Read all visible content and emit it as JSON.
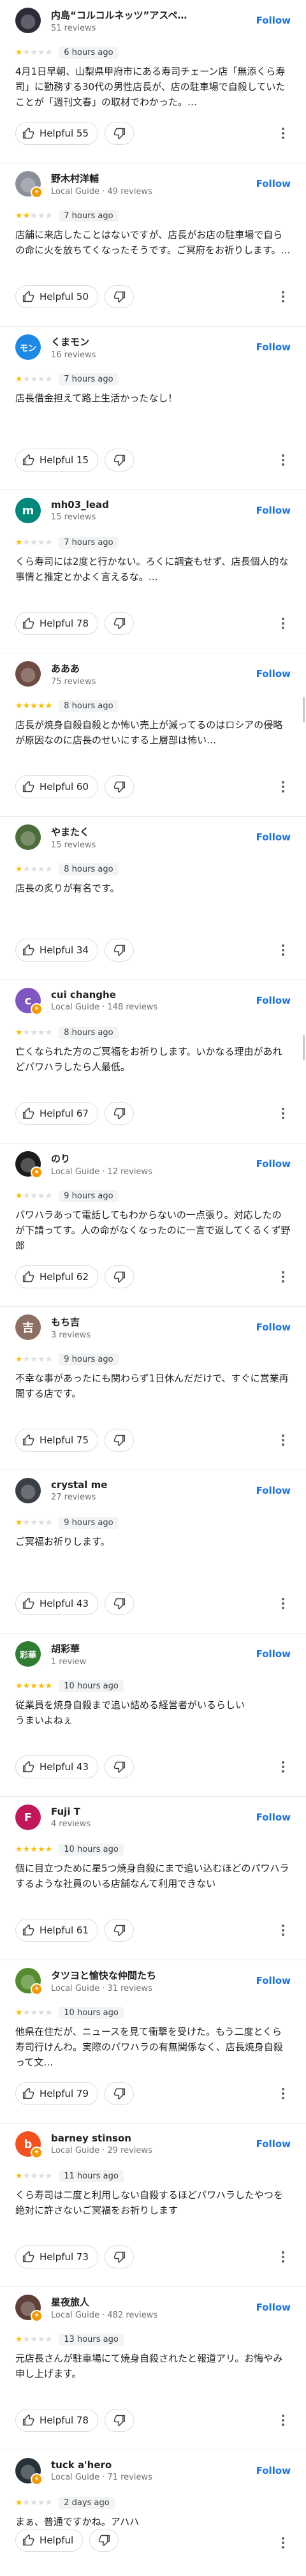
{
  "reviews": [
    {
      "name": "内島“コルコルネッツ”アスペ…",
      "avatar": {
        "kind": "photo",
        "color": "#2b2b3a",
        "glyph": "●"
      },
      "local_guide": false,
      "meta": "51 reviews",
      "follow_label": "Follow",
      "rating": 1,
      "when": "6 hours ago",
      "text": "4月1日早朝、山梨県甲府市にある寿司チェーン店「無添くら寿司」に勤務する30代の男性店長が、店の駐車場で自殺していたことが「週刊文春」の取材でわかった。…",
      "helpful_label": "Helpful 55"
    },
    {
      "name": "野木村洋輔",
      "avatar": {
        "kind": "photo",
        "color": "#8a8f9a",
        "glyph": "●"
      },
      "local_guide": true,
      "meta": "Local Guide · 49 reviews",
      "follow_label": "Follow",
      "rating": 2,
      "when": "7 hours ago",
      "text": "店舗に来店したことはないですが、店長がお店の駐車場で自らの命に火を放ちてくなったそうです。ご冥府をお祈りします。…",
      "helpful_label": "Helpful 50"
    },
    {
      "name": "くまモン",
      "avatar": {
        "kind": "letter",
        "color": "#1e88e5",
        "glyph": "モン"
      },
      "local_guide": false,
      "meta": "16 reviews",
      "follow_label": "Follow",
      "rating": 1,
      "when": "7 hours ago",
      "text": "店長借金担えて路上生活かったなし！",
      "helpful_label": "Helpful 15"
    },
    {
      "name": "mh03_lead",
      "avatar": {
        "kind": "letter",
        "color": "#00897b",
        "glyph": "m"
      },
      "local_guide": false,
      "meta": "15 reviews",
      "follow_label": "Follow",
      "rating": 1,
      "when": "7 hours ago",
      "text": "くら寿司には2度と行かない。ろくに調査もせず、店長個人的な事情と推定とかよく言えるな。…",
      "helpful_label": "Helpful 78"
    },
    {
      "name": "あああ",
      "avatar": {
        "kind": "photo",
        "color": "#6d4c41",
        "glyph": "●"
      },
      "local_guide": false,
      "meta": "75 reviews",
      "follow_label": "Follow",
      "rating": 5,
      "when": "8 hours ago",
      "text": "店長が焼身自殺自殺とか怖い売上が減ってるのはロシアの侵略が原因なのに店長のせいにする上層部は怖い…",
      "helpful_label": "Helpful 60"
    },
    {
      "name": "やまたく",
      "avatar": {
        "kind": "photo",
        "color": "#4e6b3a",
        "glyph": "●"
      },
      "local_guide": false,
      "meta": "15 reviews",
      "follow_label": "Follow",
      "rating": 1,
      "when": "8 hours ago",
      "text": "店長の炙りが有名です。",
      "helpful_label": "Helpful 34"
    },
    {
      "name": "cui changhe",
      "avatar": {
        "kind": "letter",
        "color": "#7e57c2",
        "glyph": "c"
      },
      "local_guide": true,
      "meta": "Local Guide · 148 reviews",
      "follow_label": "Follow",
      "rating": 1,
      "when": "8 hours ago",
      "text": "亡くなられた方のご冥福をお祈りします。いかなる理由があれどパワハラしたら人最低。",
      "helpful_label": "Helpful 67"
    },
    {
      "name": "のり",
      "avatar": {
        "kind": "photo",
        "color": "#1c1c1c",
        "glyph": "●"
      },
      "local_guide": true,
      "meta": "Local Guide · 12 reviews",
      "follow_label": "Follow",
      "rating": 1,
      "when": "9 hours ago",
      "text": "パワハラあって電話してもわからないの一点張り。対応したのが下請ってす。人の命がなくなったのに一言で返してくるくず野郎",
      "helpful_label": "Helpful 62"
    },
    {
      "name": "もち吉",
      "avatar": {
        "kind": "letter",
        "color": "#8d6e63",
        "glyph": "吉"
      },
      "local_guide": false,
      "meta": "3 reviews",
      "follow_label": "Follow",
      "rating": 1,
      "when": "9 hours ago",
      "text": "不幸な事があったにも関わらず1日休んだだけで、すぐに営業再開する店です。",
      "helpful_label": "Helpful 75"
    },
    {
      "name": "crystal me",
      "avatar": {
        "kind": "photo",
        "color": "#3a3f47",
        "glyph": "●"
      },
      "local_guide": false,
      "meta": "27 reviews",
      "follow_label": "Follow",
      "rating": 1,
      "when": "9 hours ago",
      "text": "ご冥福お祈りします。",
      "helpful_label": "Helpful 43"
    },
    {
      "name": "胡彩華",
      "avatar": {
        "kind": "letter",
        "color": "#2e7d32",
        "glyph": "彩華"
      },
      "local_guide": false,
      "meta": "1 review",
      "follow_label": "Follow",
      "rating": 5,
      "when": "10 hours ago",
      "text": "従業員を焼身自殺まで追い詰める経営者がいるらしい\nうまいよねぇ",
      "helpful_label": "Helpful 43"
    },
    {
      "name": "Fuji T",
      "avatar": {
        "kind": "letter",
        "color": "#c2185b",
        "glyph": "F"
      },
      "local_guide": false,
      "meta": "4 reviews",
      "follow_label": "Follow",
      "rating": 5,
      "when": "10 hours ago",
      "text": "個に目立つために星5つ焼身自殺にまで追い込むほどのパワハラするような社員のいる店舗なんて利用できない",
      "helpful_label": "Helpful 61"
    },
    {
      "name": "タツヨと愉快な仲間たち",
      "avatar": {
        "kind": "photo",
        "color": "#558b2f",
        "glyph": "●"
      },
      "local_guide": true,
      "meta": "Local Guide · 31 reviews",
      "follow_label": "Follow",
      "rating": 1,
      "when": "10 hours ago",
      "text": "他県在住だが、ニュースを見て衝撃を受けた。もう二度とくら寿司行けんわ。実際のパワハラの有無関係なく、店長焼身自殺って文…",
      "helpful_label": "Helpful 79"
    },
    {
      "name": "barney stinson",
      "avatar": {
        "kind": "letter",
        "color": "#f4511e",
        "glyph": "b"
      },
      "local_guide": true,
      "meta": "Local Guide · 29 reviews",
      "follow_label": "Follow",
      "rating": 1,
      "when": "11 hours ago",
      "text": "くら寿司は二度と利用しない自殺するほどパワハラしたやつを絶対に許さないご冥福をお祈りします",
      "helpful_label": "Helpful 73"
    },
    {
      "name": "星夜旅人",
      "avatar": {
        "kind": "photo",
        "color": "#5d4037",
        "glyph": "●"
      },
      "local_guide": true,
      "meta": "Local Guide · 482 reviews",
      "follow_label": "Follow",
      "rating": 1,
      "when": "13 hours ago",
      "text": "元店長さんが駐車場にて焼身自殺されたと報道アリ。お悔やみ申し上げます。",
      "helpful_label": "Helpful 78"
    },
    {
      "name": "tuck a'hero",
      "avatar": {
        "kind": "photo",
        "color": "#263238",
        "glyph": "●"
      },
      "local_guide": true,
      "meta": "Local Guide · 71 reviews",
      "follow_label": "Follow",
      "rating": 1,
      "when": "2 days ago",
      "text": "まぁ、普通ですかね。アハハ",
      "helpful_label": "Helpful"
    }
  ]
}
